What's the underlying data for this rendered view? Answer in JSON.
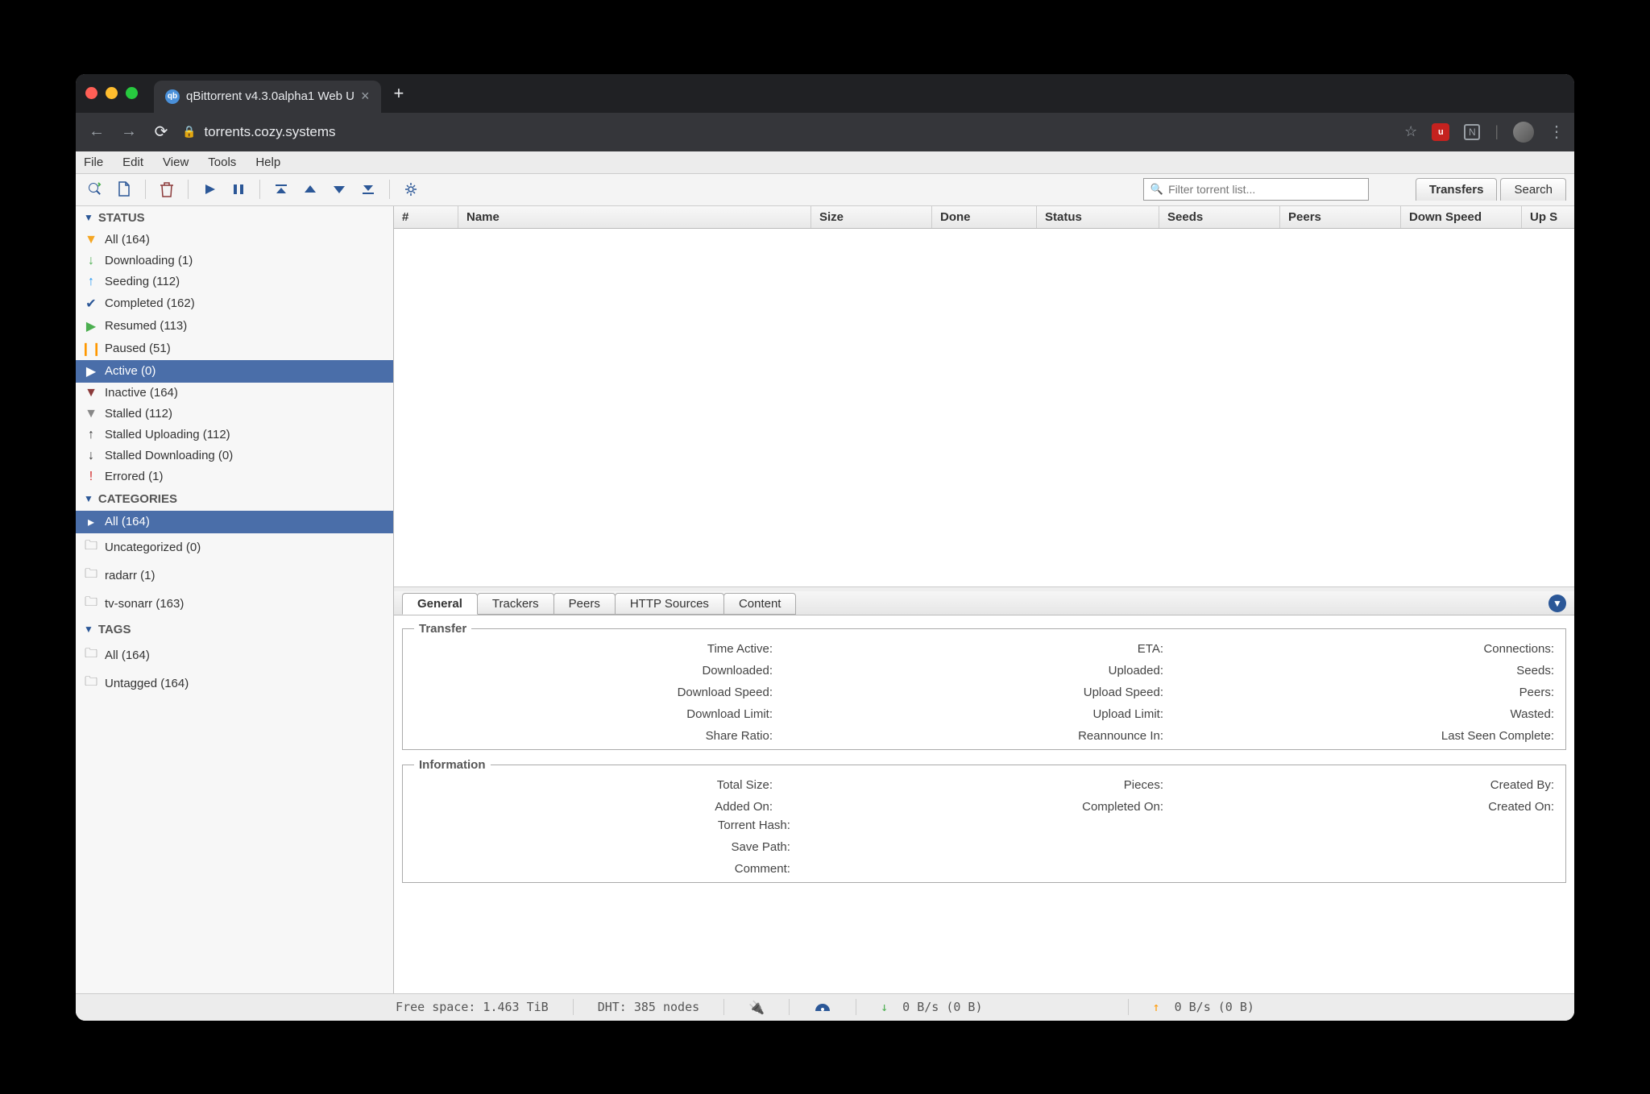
{
  "browser": {
    "tab_title": "qBittorrent v4.3.0alpha1 Web U",
    "url": "torrents.cozy.systems"
  },
  "menu": {
    "file": "File",
    "edit": "Edit",
    "view": "View",
    "tools": "Tools",
    "help": "Help"
  },
  "filter_placeholder": "Filter torrent list...",
  "view_tabs": {
    "transfers": "Transfers",
    "search": "Search"
  },
  "sidebar": {
    "status_hdr": "STATUS",
    "status": [
      {
        "icon": "▼",
        "color": "#f5a623",
        "label": "All (164)"
      },
      {
        "icon": "↓",
        "color": "#4caf50",
        "label": "Downloading (1)"
      },
      {
        "icon": "↑",
        "color": "#2196f3",
        "label": "Seeding (112)"
      },
      {
        "icon": "✔",
        "color": "#2b5797",
        "label": "Completed (162)"
      },
      {
        "icon": "▶",
        "color": "#4caf50",
        "label": "Resumed (113)"
      },
      {
        "icon": "❙❙",
        "color": "#ff9800",
        "label": "Paused (51)"
      },
      {
        "icon": "▶",
        "color": "#4caf50",
        "label": "Active (0)",
        "selected": true
      },
      {
        "icon": "▼",
        "color": "#8b3a3a",
        "label": "Inactive (164)"
      },
      {
        "icon": "▼",
        "color": "#888",
        "label": "Stalled (112)"
      },
      {
        "icon": "↑",
        "color": "#333",
        "label": "Stalled Uploading (112)"
      },
      {
        "icon": "↓",
        "color": "#333",
        "label": "Stalled Downloading (0)"
      },
      {
        "icon": "!",
        "color": "#d32f2f",
        "label": "Errored (1)"
      }
    ],
    "categories_hdr": "CATEGORIES",
    "categories": [
      {
        "icon": "▸",
        "label": "All (164)",
        "selected": true
      },
      {
        "icon": "🗀",
        "label": "Uncategorized (0)"
      },
      {
        "icon": "🗀",
        "label": "radarr (1)"
      },
      {
        "icon": "🗀",
        "label": "tv-sonarr (163)"
      }
    ],
    "tags_hdr": "TAGS",
    "tags": [
      {
        "icon": "🗀",
        "label": "All (164)"
      },
      {
        "icon": "🗀",
        "label": "Untagged (164)"
      }
    ]
  },
  "columns": {
    "num": "#",
    "name": "Name",
    "size": "Size",
    "done": "Done",
    "status": "Status",
    "seeds": "Seeds",
    "peers": "Peers",
    "down": "Down Speed",
    "up": "Up S"
  },
  "detail_tabs": {
    "general": "General",
    "trackers": "Trackers",
    "peers": "Peers",
    "http": "HTTP Sources",
    "content": "Content"
  },
  "fieldsets": {
    "transfer_legend": "Transfer",
    "transfer": {
      "time_active": "Time Active:",
      "eta": "ETA:",
      "connections": "Connections:",
      "downloaded": "Downloaded:",
      "uploaded": "Uploaded:",
      "seeds": "Seeds:",
      "dl_speed": "Download Speed:",
      "ul_speed": "Upload Speed:",
      "peers": "Peers:",
      "dl_limit": "Download Limit:",
      "ul_limit": "Upload Limit:",
      "wasted": "Wasted:",
      "ratio": "Share Ratio:",
      "reannounce": "Reannounce In:",
      "last_seen": "Last Seen Complete:"
    },
    "info_legend": "Information",
    "info": {
      "total_size": "Total Size:",
      "pieces": "Pieces:",
      "created_by": "Created By:",
      "added_on": "Added On:",
      "completed_on": "Completed On:",
      "created_on": "Created On:",
      "hash": "Torrent Hash:",
      "save_path": "Save Path:",
      "comment": "Comment:"
    }
  },
  "statusbar": {
    "free_space": "Free space: 1.463 TiB",
    "dht": "DHT: 385 nodes",
    "dl": "0 B/s (0 B)",
    "ul": "0 B/s (0 B)"
  }
}
